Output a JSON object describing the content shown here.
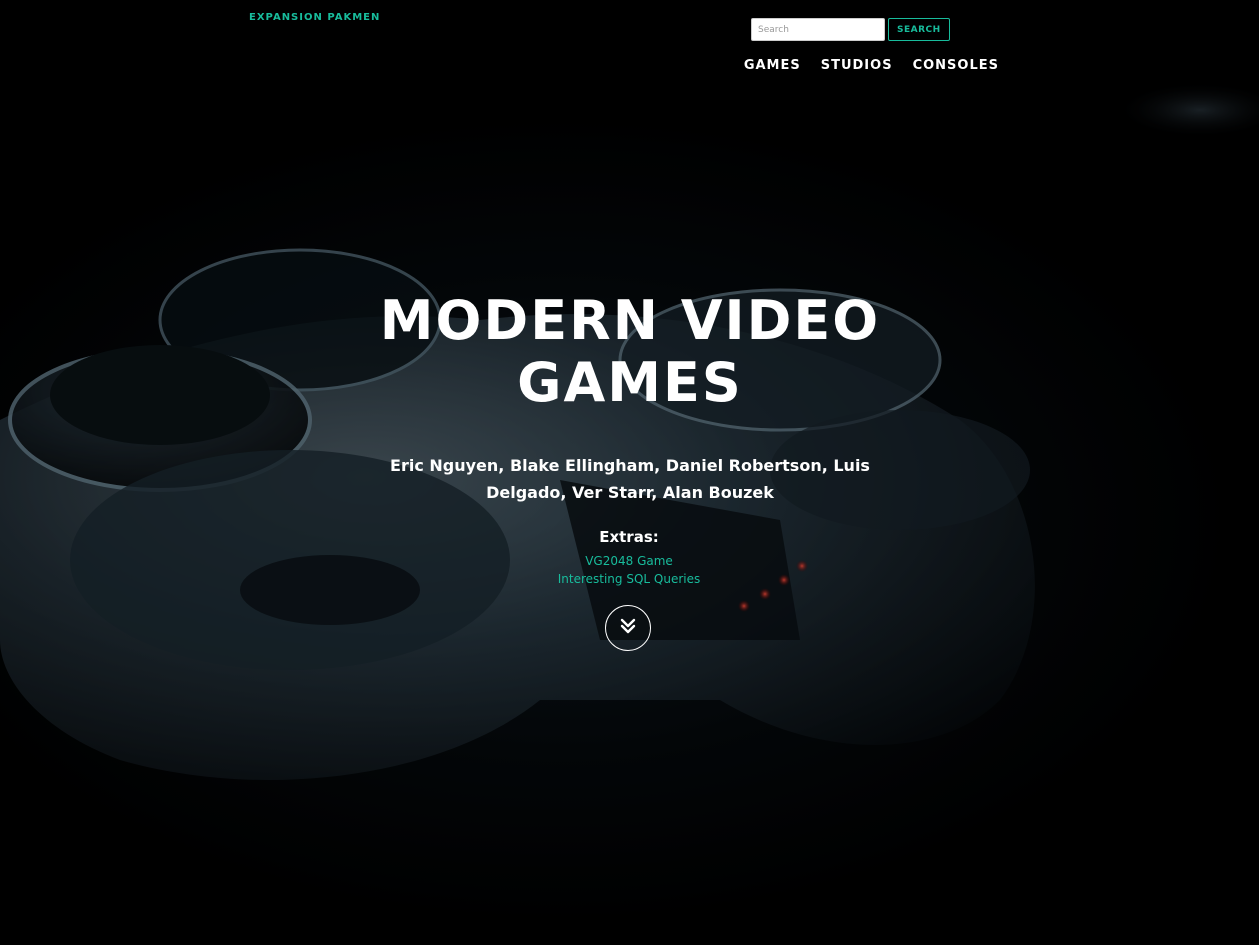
{
  "brand": "EXPANSION PAKMEN",
  "search": {
    "placeholder": "Search",
    "button_label": "SEARCH"
  },
  "nav": {
    "items": [
      "GAMES",
      "STUDIOS",
      "CONSOLES"
    ]
  },
  "hero": {
    "title": "MODERN VIDEO GAMES",
    "authors": "Eric Nguyen, Blake Ellingham, Daniel Robertson, Luis Delgado, Ver Starr, Alan Bouzek",
    "extras_label": "Extras:",
    "extras_links": [
      "VG2048 Game",
      "Interesting SQL Queries"
    ],
    "scroll_icon": "double-chevron-down-icon"
  },
  "colors": {
    "accent": "#18bc9c",
    "background": "#000000",
    "text": "#ffffff"
  }
}
